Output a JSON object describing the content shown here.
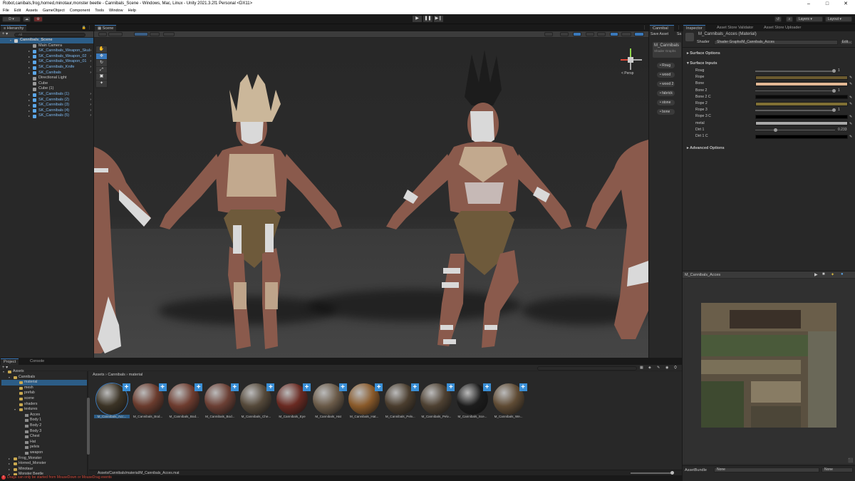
{
  "window": {
    "title": "Robot,canibals,frog,horned,minotaur,monster beetle - Cannibals_Scene - Windows, Mac, Linux - Unity 2021.3.2f1 Personal <DX11>",
    "minimize": "–",
    "maximize": "□",
    "close": "✕"
  },
  "menu": [
    "File",
    "Edit",
    "Assets",
    "GameObject",
    "Component",
    "Tools",
    "Window",
    "Help"
  ],
  "toolbar": {
    "account": "D ▾",
    "layers": "Layers",
    "layout": "Layout",
    "play": "▶",
    "pause": "❚❚",
    "step": "▶❙"
  },
  "hierarchy": {
    "tab": "Hierarchy",
    "add": "+ ▾",
    "search_placeholder": "All",
    "items": [
      {
        "label": "Cannibals_Scene",
        "indent": 0,
        "type": "scene",
        "selected": true
      },
      {
        "label": "Main Camera",
        "indent": 1,
        "type": "object"
      },
      {
        "label": "SK_Cannibals_Weapon_Skul",
        "indent": 1,
        "type": "prefab",
        "arrow": true
      },
      {
        "label": "SK_Cannibals_Weapon_02",
        "indent": 1,
        "type": "prefab",
        "arrow": true
      },
      {
        "label": "SK_Cannibals_Weapon_01",
        "indent": 1,
        "type": "prefab",
        "arrow": true
      },
      {
        "label": "SK_Cannibals_Knife",
        "indent": 1,
        "type": "prefab",
        "arrow": true
      },
      {
        "label": "SK_Canibals",
        "indent": 1,
        "type": "prefab",
        "arrow": true
      },
      {
        "label": "Directional Light",
        "indent": 1,
        "type": "object"
      },
      {
        "label": "Cube",
        "indent": 1,
        "type": "object"
      },
      {
        "label": "Cube (1)",
        "indent": 1,
        "type": "object"
      },
      {
        "label": "SK_Cannibals (1)",
        "indent": 1,
        "type": "prefab",
        "arrow": true
      },
      {
        "label": "SK_Cannibals (2)",
        "indent": 1,
        "type": "prefab",
        "arrow": true
      },
      {
        "label": "SK_Cannibals (3)",
        "indent": 1,
        "type": "prefab",
        "arrow": true
      },
      {
        "label": "SK_Cannibals (4)",
        "indent": 1,
        "type": "prefab",
        "arrow": true
      },
      {
        "label": "SK_Cannibals (5)",
        "indent": 1,
        "type": "prefab",
        "arrow": true
      }
    ]
  },
  "scene": {
    "tab": "Scene",
    "persp": "< Persp",
    "tools": [
      "✋",
      "✥",
      "↻",
      "⤢",
      "▣",
      "✦"
    ]
  },
  "material_panel": {
    "tab": "Cannibal",
    "save_asset": "Save Asset",
    "save_as": "Sa",
    "title": "M_Cannibals",
    "shader_hint": "Shader Graphs",
    "pills": [
      "Roug",
      "wood",
      "wood 2",
      "fabrick",
      "stone",
      "bone"
    ]
  },
  "inspector": {
    "tabs": [
      "Inspector",
      "Asset Store Validator",
      "Asset Store Uploader"
    ],
    "title": "M_Cannibals_Acces (Material)",
    "shader_label": "Shader",
    "shader_value": "Shader Graphs/M_Cannibals_Acces",
    "edit": "Edit...",
    "surface_options": "Surface Options",
    "surface_inputs": "Surface Inputs",
    "advanced_options": "Advanced Options",
    "props": [
      {
        "label": "Roug",
        "kind": "slider",
        "value": "1",
        "fill": 0.98
      },
      {
        "label": "Rope",
        "kind": "color",
        "color": "#6b5a2f"
      },
      {
        "label": "Bone",
        "kind": "color",
        "color": "#e2b894"
      },
      {
        "label": "Bone 2",
        "kind": "slider",
        "value": "1",
        "fill": 0.98
      },
      {
        "label": "Bone 2 C",
        "kind": "color",
        "color": "#0a0a0a"
      },
      {
        "label": "Rope 2",
        "kind": "color",
        "color": "#807034"
      },
      {
        "label": "Rope 3",
        "kind": "slider",
        "value": "1",
        "fill": 0.98
      },
      {
        "label": "Rope 3 C",
        "kind": "color",
        "color": "#000000"
      },
      {
        "label": "metal",
        "kind": "color",
        "color": "#a9a9a9"
      },
      {
        "label": "Dirt 1",
        "kind": "slider",
        "value": "0.233",
        "fill": 0.233
      },
      {
        "label": "Dirt 1 C",
        "kind": "color",
        "color": "#000000"
      }
    ],
    "preview_title": "M_Cannibals_Acces",
    "assetbundle_label": "AssetBundle",
    "assetbundle_value": "None",
    "assetbundle_variant": "None"
  },
  "project": {
    "tabs": [
      "Project",
      "Console"
    ],
    "breadcrumb": [
      "Assets",
      "Cannibals",
      "material"
    ],
    "search_placeholder": "",
    "tree": [
      {
        "label": "Assets",
        "indent": 0,
        "arrow": "▾"
      },
      {
        "label": "Cannibals",
        "indent": 1,
        "arrow": "▾"
      },
      {
        "label": "material",
        "indent": 2,
        "selected": true
      },
      {
        "label": "mesh",
        "indent": 2
      },
      {
        "label": "prefab",
        "indent": 2
      },
      {
        "label": "scene",
        "indent": 2
      },
      {
        "label": "shaders",
        "indent": 2
      },
      {
        "label": "textures",
        "indent": 2,
        "arrow": "▾"
      },
      {
        "label": "Acces",
        "indent": 3,
        "tex": true
      },
      {
        "label": "Body 1",
        "indent": 3,
        "tex": true
      },
      {
        "label": "Body 2",
        "indent": 3,
        "tex": true
      },
      {
        "label": "Body 3",
        "indent": 3,
        "tex": true
      },
      {
        "label": "Chest",
        "indent": 3,
        "tex": true
      },
      {
        "label": "Hat",
        "indent": 3,
        "tex": true
      },
      {
        "label": "pelvis",
        "indent": 3,
        "tex": true
      },
      {
        "label": "weapon",
        "indent": 3,
        "tex": true
      },
      {
        "label": "Frog_Monster",
        "indent": 1,
        "arrow": "▸"
      },
      {
        "label": "Horned_Monster",
        "indent": 1,
        "arrow": "▸"
      },
      {
        "label": "Minotaur",
        "indent": 1,
        "arrow": "▸"
      },
      {
        "label": "Monster Beetle",
        "indent": 1,
        "arrow": "▸"
      }
    ],
    "assets": [
      {
        "label": "M_Cannibals_Acc...",
        "color": "#3b3325",
        "selected": true
      },
      {
        "label": "M_Cannibals_Bod...",
        "color": "#6a3b2d"
      },
      {
        "label": "M_Cannibals_Bod...",
        "color": "#6e3c2f"
      },
      {
        "label": "M_Cannibals_Bod...",
        "color": "#6b3f34"
      },
      {
        "label": "M_Cannibals_Che...",
        "color": "#55493a"
      },
      {
        "label": "M_Cannibals_Eye",
        "color": "#6a2a22"
      },
      {
        "label": "M_Cannibals_Hat",
        "color": "#6a5a48"
      },
      {
        "label": "M_Cannibals_Hat...",
        "color": "#8a5a2a"
      },
      {
        "label": "M_Cannibals_Pelv...",
        "color": "#4a3d2e"
      },
      {
        "label": "M_Cannibals_Pelv...",
        "color": "#4e4132"
      },
      {
        "label": "M_Cannibals_Sce...",
        "color": "#1c1c1c"
      },
      {
        "label": "M_Cannibals_We...",
        "color": "#5f4b34"
      }
    ],
    "path": "Assets/Cannibals/material/M_Cannibals_Acces.mat"
  },
  "status": {
    "message": "Drags can only be started from MouseDown or MouseDrag events"
  }
}
